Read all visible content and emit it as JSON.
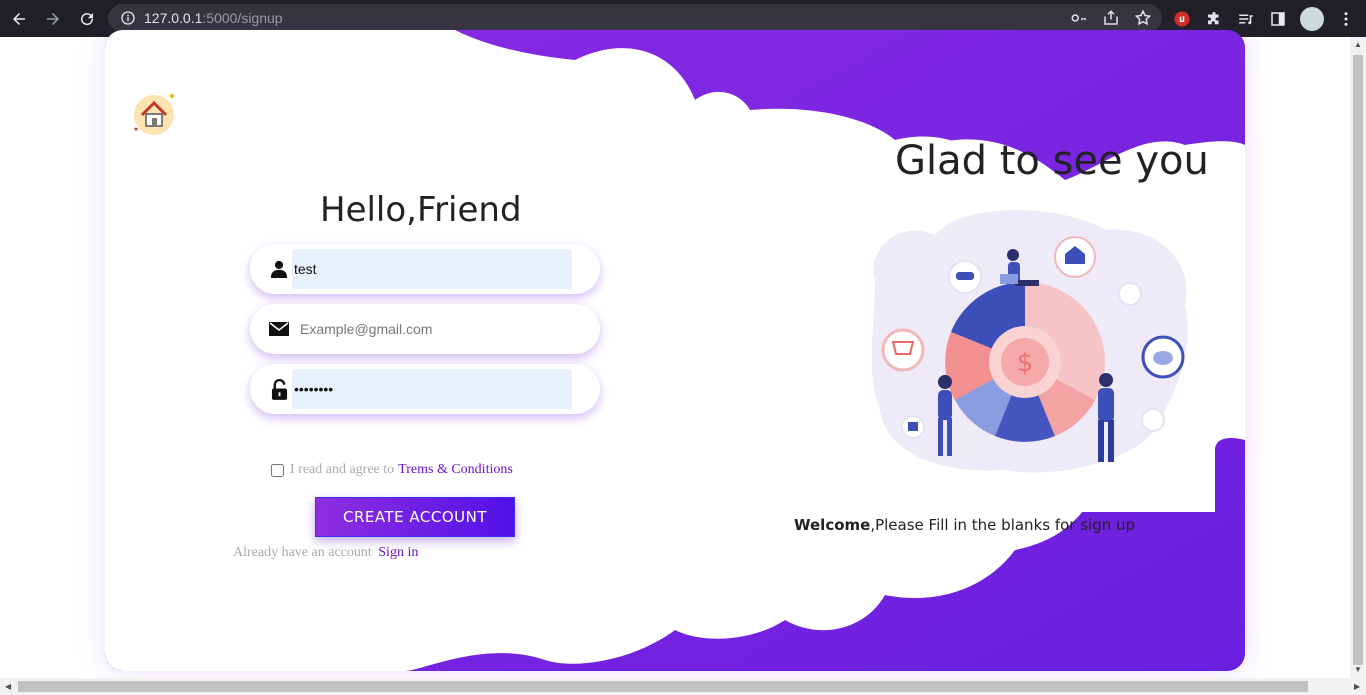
{
  "browser": {
    "url_host": "127.0.0.1",
    "url_path": ":5000/signup"
  },
  "form": {
    "title": "Hello,Friend",
    "username_value": "test",
    "email_placeholder": "Example@gmail.com",
    "password_value": "••••••••",
    "terms_prefix": "I read and agree to",
    "terms_link": "Trems & Conditions",
    "create_button": "CREATE ACCOUNT",
    "signin_prefix": "Already have an account",
    "signin_link": "Sign in"
  },
  "right": {
    "headline": "Glad to see you",
    "welcome_bold": "Welcome",
    "welcome_rest": ",Please Fill in the blanks for sign up"
  },
  "colors": {
    "accent": "#7b24e3",
    "link": "#6a13c9",
    "button_start": "#8f2fe0",
    "button_end": "#5211e8"
  },
  "icons": [
    "back-icon",
    "forward-icon",
    "reload-icon",
    "info-icon",
    "key-icon",
    "share-icon",
    "star-icon",
    "extension-icon",
    "puzzle-icon",
    "media-icon",
    "sidepanel-icon",
    "menu-icon",
    "home-icon",
    "user-icon",
    "mail-icon",
    "lock-icon"
  ]
}
